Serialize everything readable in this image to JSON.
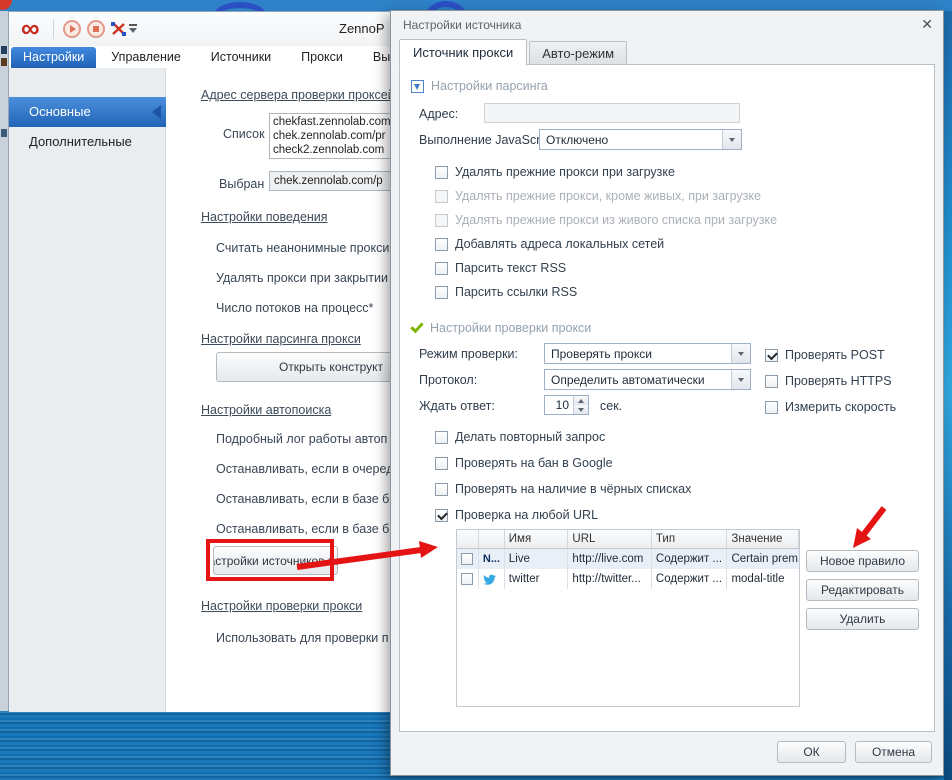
{
  "main": {
    "logo_glyph": "∞",
    "title": "ZennoP",
    "tabs": [
      {
        "label": "Настройки"
      },
      {
        "label": "Управление"
      },
      {
        "label": "Источники"
      },
      {
        "label": "Прокси"
      },
      {
        "label": "Выдача"
      }
    ],
    "sidebar": [
      {
        "label": "Основные"
      },
      {
        "label": "Дополнительные"
      }
    ],
    "content": {
      "server_header": "Адрес сервера проверки проксей",
      "list_label": "Список",
      "list_value": "chekfast.zennolab.com\nchek.zennolab.com/pr\ncheck2.zennolab.com",
      "selected_label": "Выбран",
      "selected_value": "chek.zennolab.com/p",
      "behavior_header": "Настройки поведения",
      "behavior_items": [
        "Считать неанонимные прокси",
        "Удалять прокси при закрытии",
        "Число потоков на процесс*"
      ],
      "parsing_header": "Настройки парсинга прокси",
      "open_constructor_button": "Открыть конструкт",
      "autosearch_header": "Настройки автопоиска",
      "autosearch_items": [
        "Подробный лог работы автоп",
        "Останавливать, если в очеред",
        "Останавливать, если в базе б",
        "Останавливать, если в базе б"
      ],
      "sources_button": "Настройки источников по-у",
      "checking_header": "Настройки проверки прокси",
      "checking_items": [
        "Использовать для проверки п"
      ]
    }
  },
  "dialog": {
    "title": "Настройки источника",
    "close_glyph": "✕",
    "tabs": [
      {
        "label": "Источник прокси"
      },
      {
        "label": "Авто-режим"
      }
    ],
    "parsing": {
      "header": "Настройки парсинга",
      "address_label": "Адрес:",
      "address_value": "",
      "js_label": "Выполнение JavaScript:",
      "js_value": "Отключено",
      "checkboxes": [
        {
          "label": "Удалять прежние прокси при загрузке",
          "checked": false,
          "disabled": false
        },
        {
          "label": "Удалять прежние прокси, кроме живых, при загрузке",
          "checked": false,
          "disabled": true
        },
        {
          "label": "Удалять прежние прокси из живого списка при загрузке",
          "checked": false,
          "disabled": true
        },
        {
          "label": "Добавлять адреса локальных сетей",
          "checked": false,
          "disabled": false
        },
        {
          "label": "Парсить текст RSS",
          "checked": false,
          "disabled": false
        },
        {
          "label": "Парсить ссылки RSS",
          "checked": false,
          "disabled": false
        }
      ]
    },
    "checking": {
      "header": "Настройки проверки прокси",
      "mode_label": "Режим проверки:",
      "mode_value": "Проверять прокси",
      "protocol_label": "Протокол:",
      "protocol_value": "Определить автоматически",
      "wait_label": "Ждать ответ:",
      "wait_value": "10",
      "wait_unit": "сек.",
      "right_checkboxes": [
        {
          "label": "Проверять POST",
          "checked": true
        },
        {
          "label": "Проверять HTTPS",
          "checked": false
        },
        {
          "label": "Измерить скорость",
          "checked": false
        }
      ],
      "extra_checkboxes": [
        {
          "label": "Делать повторный запрос",
          "checked": false
        },
        {
          "label": "Проверять на бан в Google",
          "checked": false
        },
        {
          "label": "Проверять на наличие в чёрных списках",
          "checked": false
        },
        {
          "label": "Проверка на любой URL",
          "checked": true
        }
      ]
    },
    "rules_table": {
      "columns": [
        "Имя",
        "URL",
        "Тип",
        "Значение"
      ],
      "rows": [
        {
          "icon": "N...",
          "name": "Live",
          "url": "http://live.com",
          "type": "Содержит ...",
          "value": "Certain prem..."
        },
        {
          "icon": "twitter-bird",
          "name": "twitter",
          "url": "http://twitter...",
          "type": "Содержит ...",
          "value": "modal-title"
        }
      ]
    },
    "side_buttons": [
      {
        "label": "Новое правило"
      },
      {
        "label": "Редактировать"
      },
      {
        "label": "Удалить"
      }
    ],
    "footer": {
      "ok": "ОК",
      "cancel": "Отмена"
    }
  },
  "colors": {
    "annotation_red": "#e51414",
    "selection_blue": "#2f6fc4",
    "twitter_blue": "#35a9e1"
  }
}
